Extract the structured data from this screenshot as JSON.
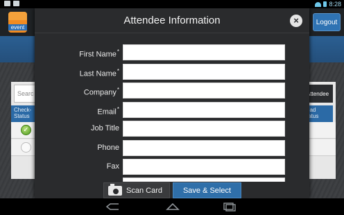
{
  "status_bar": {
    "time": "8:28",
    "left_icons": [
      "image-notification-icon",
      "mail-notification-icon"
    ],
    "right_icons": [
      "wifi-icon",
      "battery-icon"
    ]
  },
  "background_app": {
    "logo_text": "event",
    "logout_label": "Logout",
    "search_placeholder": "Searc",
    "attendee_button_label": "Attendee",
    "col_left_line1": "Check-",
    "col_left_line2": "Status",
    "col_right_line1": "ead",
    "col_right_line2": "tatus",
    "rows": [
      {
        "checked": true
      },
      {
        "checked": false
      }
    ]
  },
  "modal": {
    "title": "Attendee Information",
    "fields": [
      {
        "label": "First Name",
        "required": true,
        "value": ""
      },
      {
        "label": "Last Name",
        "required": true,
        "value": ""
      },
      {
        "label": "Company",
        "required": true,
        "value": ""
      },
      {
        "label": "Email",
        "required": true,
        "value": ""
      },
      {
        "label": "Job Title",
        "required": false,
        "value": ""
      },
      {
        "label": "Phone",
        "required": false,
        "value": ""
      },
      {
        "label": "Fax",
        "required": false,
        "value": ""
      }
    ],
    "required_marker": "*",
    "scan_card_label": "Scan Card",
    "save_select_label": "Save & Select"
  },
  "navigation_bar": {
    "buttons": [
      "back-icon",
      "home-icon",
      "recent-apps-icon"
    ]
  },
  "colors": {
    "accent_blue": "#2f6fa9",
    "modal_bg": "#2a2b2d",
    "logo_orange": "#f18b21",
    "check_green": "#4f9a1e"
  }
}
